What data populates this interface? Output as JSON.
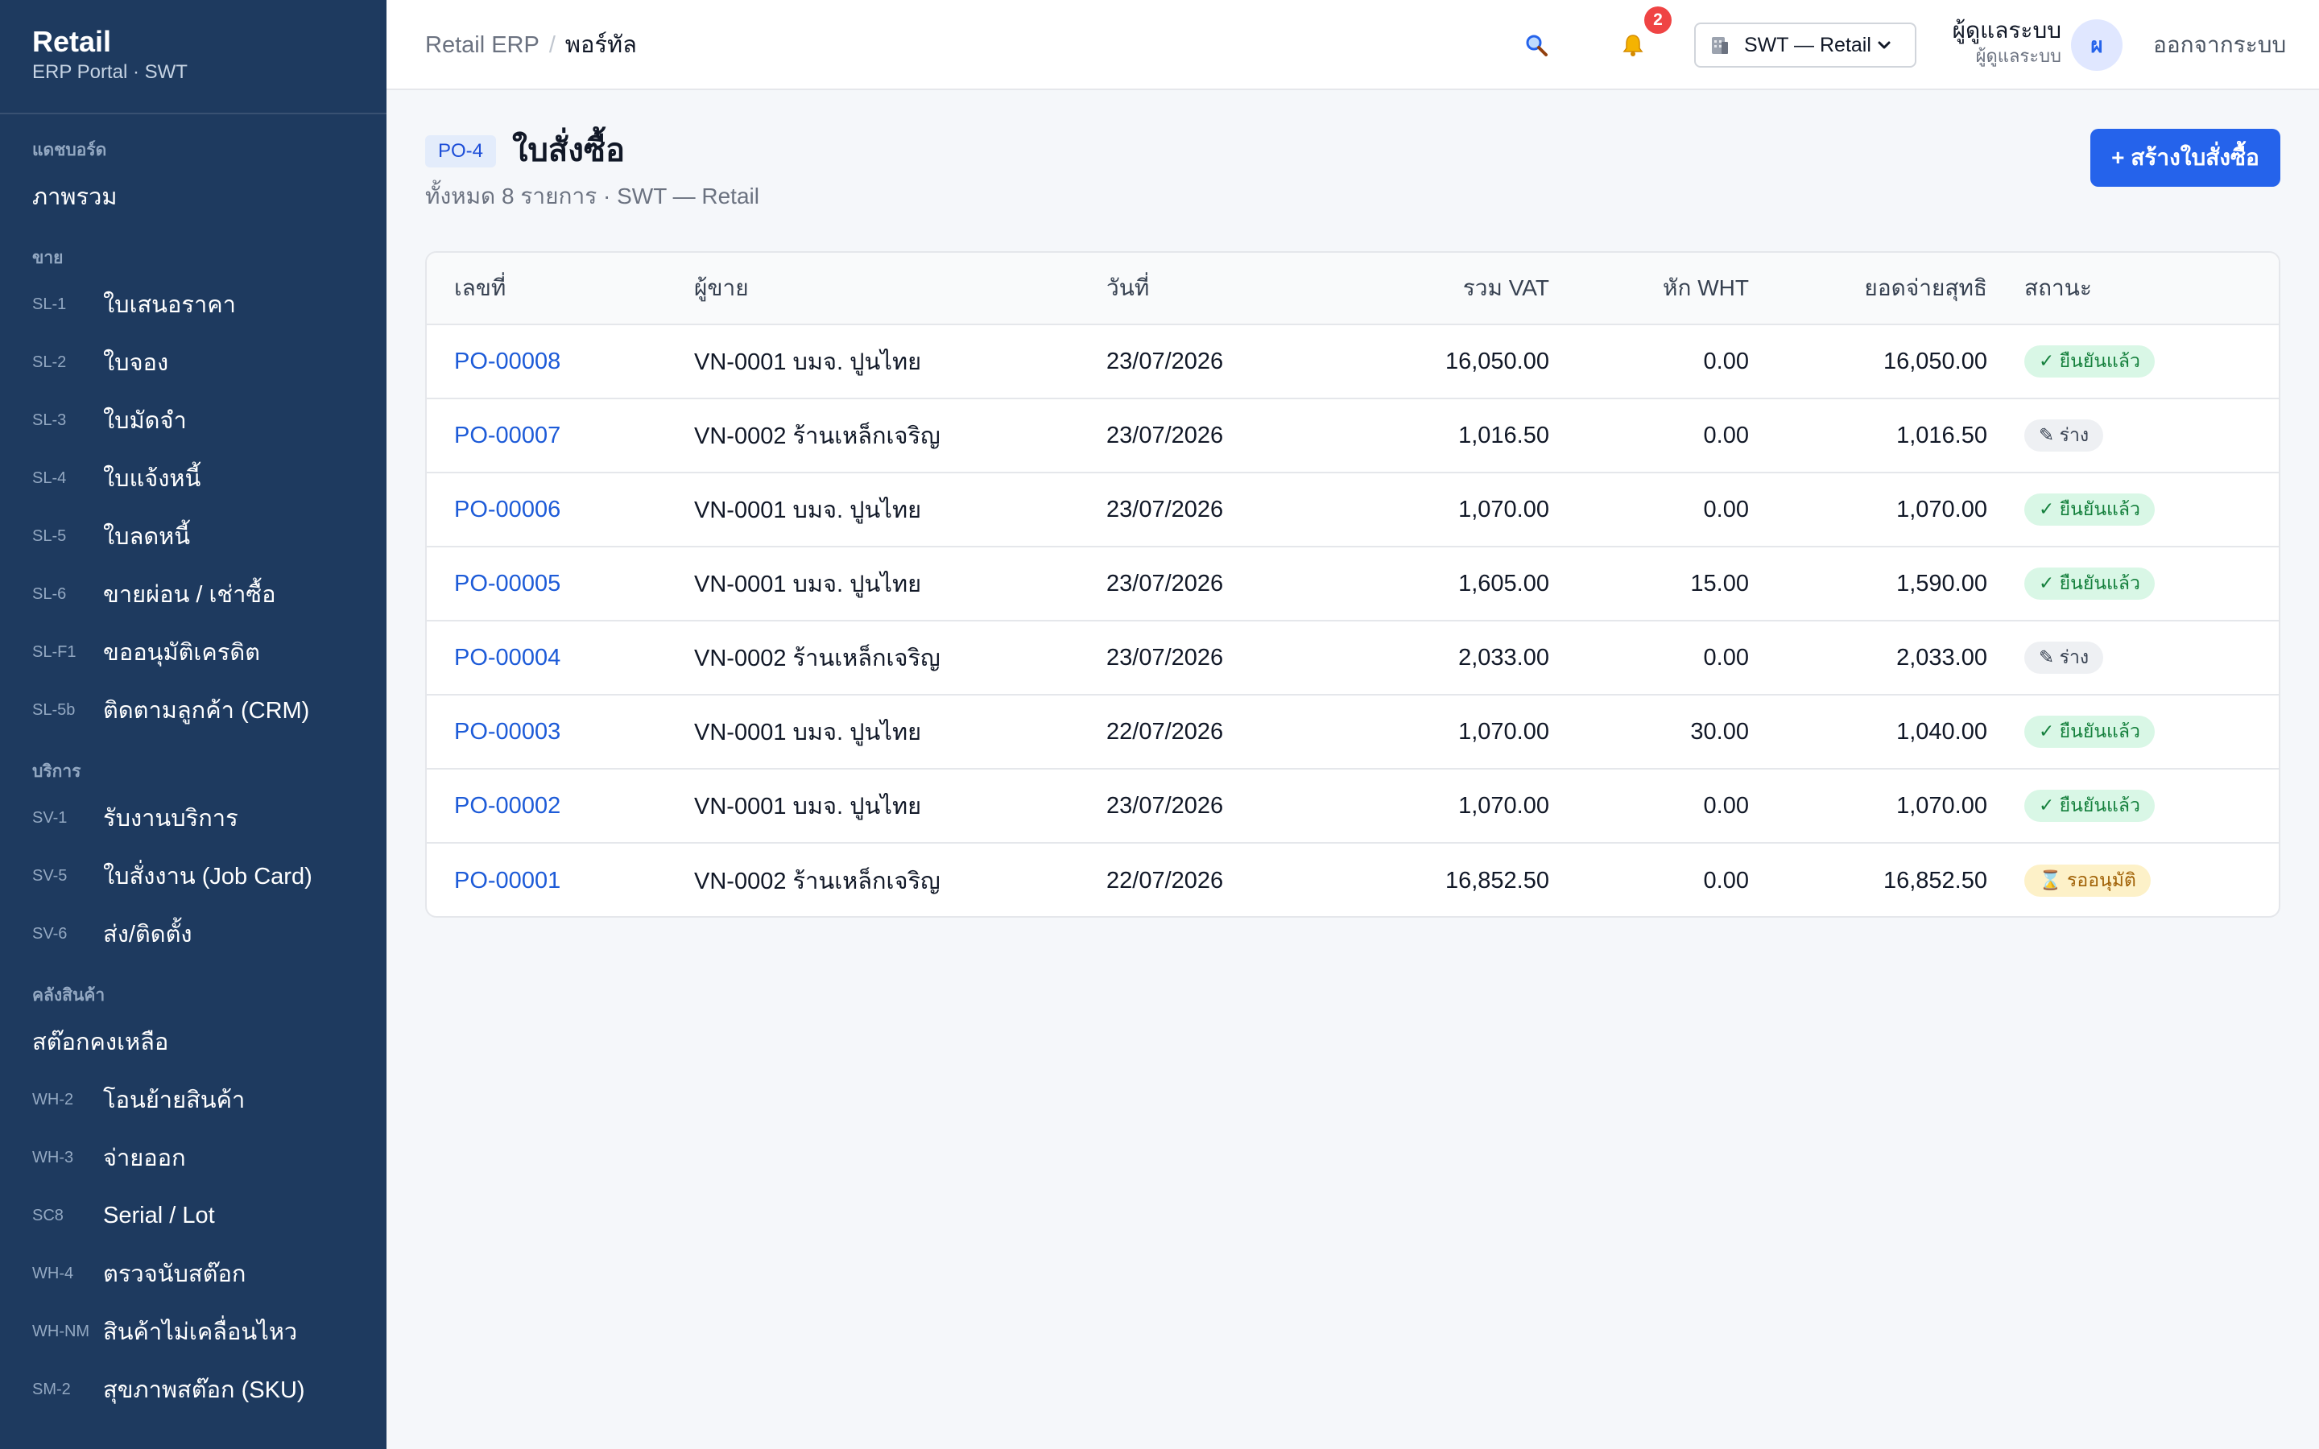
{
  "sidebar": {
    "brand_title": "Retail",
    "brand_sub": "ERP Portal · SWT",
    "sections": [
      {
        "title": "แดชบอร์ด",
        "items": [
          {
            "code": "",
            "label": "ภาพรวม"
          }
        ]
      },
      {
        "title": "ขาย",
        "items": [
          {
            "code": "SL-1",
            "label": "ใบเสนอราคา"
          },
          {
            "code": "SL-2",
            "label": "ใบจอง"
          },
          {
            "code": "SL-3",
            "label": "ใบมัดจำ"
          },
          {
            "code": "SL-4",
            "label": "ใบแจ้งหนี้"
          },
          {
            "code": "SL-5",
            "label": "ใบลดหนี้"
          },
          {
            "code": "SL-6",
            "label": "ขายผ่อน / เช่าซื้อ"
          },
          {
            "code": "SL-F1",
            "label": "ขออนุมัติเครดิต"
          },
          {
            "code": "SL-5b",
            "label": "ติดตามลูกค้า (CRM)"
          }
        ]
      },
      {
        "title": "บริการ",
        "items": [
          {
            "code": "SV-1",
            "label": "รับงานบริการ"
          },
          {
            "code": "SV-5",
            "label": "ใบสั่งงาน (Job Card)"
          },
          {
            "code": "SV-6",
            "label": "ส่ง/ติดตั้ง"
          }
        ]
      },
      {
        "title": "คลังสินค้า",
        "items": [
          {
            "code": "",
            "label": "สต๊อกคงเหลือ"
          },
          {
            "code": "WH-2",
            "label": "โอนย้ายสินค้า"
          },
          {
            "code": "WH-3",
            "label": "จ่ายออก"
          },
          {
            "code": "SC8",
            "label": "Serial / Lot"
          },
          {
            "code": "WH-4",
            "label": "ตรวจนับสต๊อก"
          },
          {
            "code": "WH-NM",
            "label": "สินค้าไม่เคลื่อนไหว"
          },
          {
            "code": "SM-2",
            "label": "สุขภาพสต๊อก (SKU)"
          }
        ]
      }
    ]
  },
  "topbar": {
    "breadcrumb_root": "Retail ERP",
    "breadcrumb_sep": "/",
    "breadcrumb_current": "พอร์ทัล",
    "search_icon": "search-icon",
    "bell_icon": "bell-icon",
    "notification_count": "2",
    "branch_icon": "building-icon",
    "branch_label": "SWT — Retail",
    "user_name": "ผู้ดูแลระบบ",
    "user_role": "ผู้ดูแลระบบ",
    "avatar_initial": "ผ",
    "logout_label": "ออกจากระบบ"
  },
  "page": {
    "code": "PO-4",
    "title": "ใบสั่งซื้อ",
    "subtitle": "ทั้งหมด 8 รายการ · SWT — Retail",
    "create_label": "+ สร้างใบสั่งซื้อ"
  },
  "table": {
    "headers": {
      "no": "เลขที่",
      "vendor": "ผู้ขาย",
      "date": "วันที่",
      "vat": "รวม VAT",
      "wht": "หัก WHT",
      "net": "ยอดจ่ายสุทธิ",
      "status": "สถานะ"
    },
    "rows": [
      {
        "no": "PO-00008",
        "vendor": "VN-0001 บมจ. ปูนไทย",
        "date": "23/07/2026",
        "vat": "16,050.00",
        "wht": "0.00",
        "net": "16,050.00",
        "status": "✓ ยืนยันแล้ว",
        "status_kind": "confirmed"
      },
      {
        "no": "PO-00007",
        "vendor": "VN-0002 ร้านเหล็กเจริญ",
        "date": "23/07/2026",
        "vat": "1,016.50",
        "wht": "0.00",
        "net": "1,016.50",
        "status": "✎ ร่าง",
        "status_kind": "draft"
      },
      {
        "no": "PO-00006",
        "vendor": "VN-0001 บมจ. ปูนไทย",
        "date": "23/07/2026",
        "vat": "1,070.00",
        "wht": "0.00",
        "net": "1,070.00",
        "status": "✓ ยืนยันแล้ว",
        "status_kind": "confirmed"
      },
      {
        "no": "PO-00005",
        "vendor": "VN-0001 บมจ. ปูนไทย",
        "date": "23/07/2026",
        "vat": "1,605.00",
        "wht": "15.00",
        "net": "1,590.00",
        "status": "✓ ยืนยันแล้ว",
        "status_kind": "confirmed"
      },
      {
        "no": "PO-00004",
        "vendor": "VN-0002 ร้านเหล็กเจริญ",
        "date": "23/07/2026",
        "vat": "2,033.00",
        "wht": "0.00",
        "net": "2,033.00",
        "status": "✎ ร่าง",
        "status_kind": "draft"
      },
      {
        "no": "PO-00003",
        "vendor": "VN-0001 บมจ. ปูนไทย",
        "date": "22/07/2026",
        "vat": "1,070.00",
        "wht": "30.00",
        "net": "1,040.00",
        "status": "✓ ยืนยันแล้ว",
        "status_kind": "confirmed"
      },
      {
        "no": "PO-00002",
        "vendor": "VN-0001 บมจ. ปูนไทย",
        "date": "23/07/2026",
        "vat": "1,070.00",
        "wht": "0.00",
        "net": "1,070.00",
        "status": "✓ ยืนยันแล้ว",
        "status_kind": "confirmed"
      },
      {
        "no": "PO-00001",
        "vendor": "VN-0002 ร้านเหล็กเจริญ",
        "date": "22/07/2026",
        "vat": "16,852.50",
        "wht": "0.00",
        "net": "16,852.50",
        "status": "⌛ รออนุมัติ",
        "status_kind": "pending"
      }
    ]
  },
  "colors": {
    "sidebar_bg": "#1e3a5f",
    "accent": "#2563eb",
    "link": "#1d5bd8",
    "badge": "#ef4444"
  }
}
